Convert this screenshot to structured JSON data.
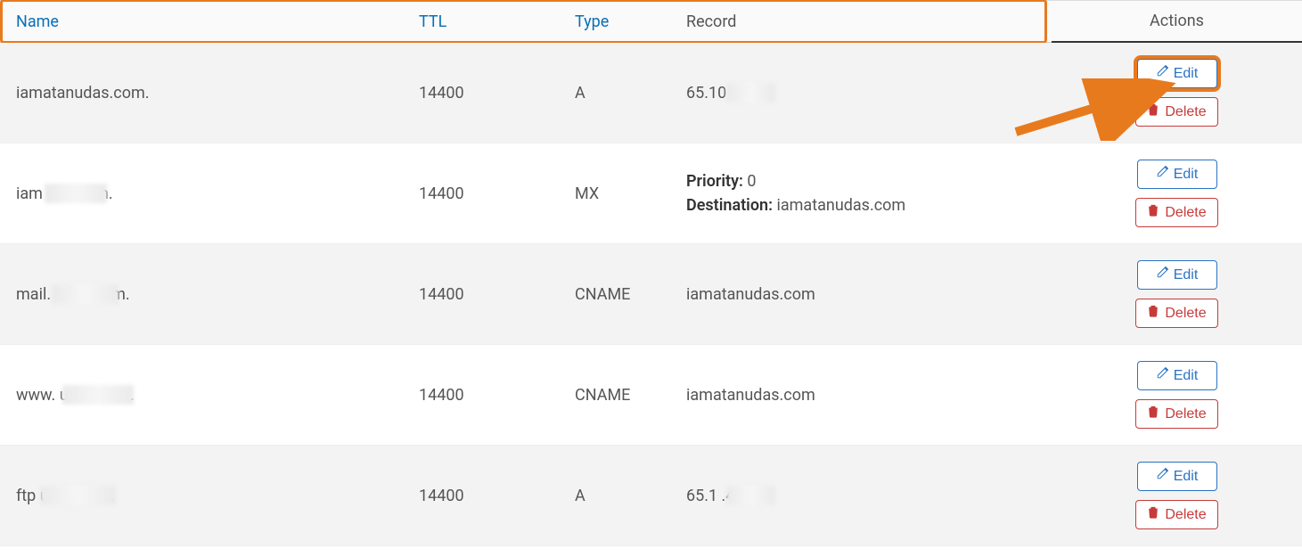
{
  "header": {
    "name": "Name",
    "ttl": "TTL",
    "type": "Type",
    "record": "Record",
    "actions": "Actions"
  },
  "buttons": {
    "edit": "Edit",
    "delete": "Delete"
  },
  "recordLabels": {
    "priority": "Priority:",
    "destination": "Destination:"
  },
  "rows": [
    {
      "name": "iamatanudas.com.",
      "ttl": "14400",
      "type": "A",
      "recordText": "65.10        .47",
      "recordBlur": true,
      "nameBlur": false,
      "alt": true,
      "editHighlight": true
    },
    {
      "name": "iam         das.com.",
      "ttl": "14400",
      "type": "MX",
      "priorityValue": "0",
      "destinationValue": "iamatanudas.com",
      "recordBlur": false,
      "nameBlur": true,
      "alt": false
    },
    {
      "name": "mail.          udas.com.",
      "ttl": "14400",
      "type": "CNAME",
      "recordText": "iamatanudas.com",
      "recordBlur": false,
      "nameBlur": true,
      "alt": true
    },
    {
      "name": "www.             udas.com.",
      "ttl": "14400",
      "type": "CNAME",
      "recordText": "iamatanudas.com",
      "recordBlur": false,
      "nameBlur": true,
      "alt": false
    },
    {
      "name": "ftp            udas.com.",
      "ttl": "14400",
      "type": "A",
      "recordText": "65.1         .47",
      "recordBlur": true,
      "nameBlur": true,
      "alt": true
    }
  ]
}
